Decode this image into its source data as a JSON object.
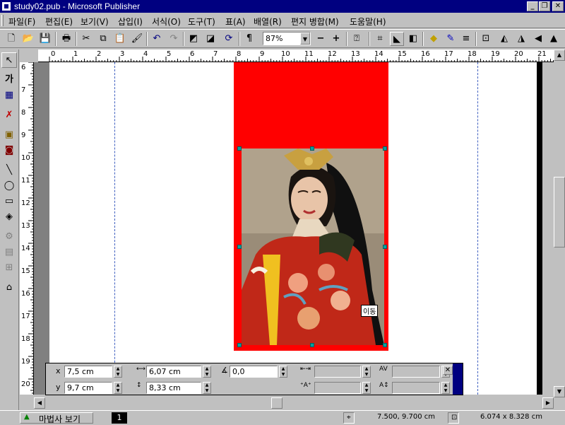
{
  "window": {
    "title": "study02.pub - Microsoft Publisher"
  },
  "menu": [
    "파일(F)",
    "편집(E)",
    "보기(V)",
    "삽입(I)",
    "서식(O)",
    "도구(T)",
    "표(A)",
    "배열(R)",
    "편지 병합(M)",
    "도움말(H)"
  ],
  "toolbar": {
    "zoom": "87%"
  },
  "ruler": {
    "h_labels": [
      "0",
      "1",
      "2",
      "3",
      "4",
      "5",
      "6",
      "7",
      "8",
      "9",
      "10",
      "11",
      "12",
      "13",
      "14",
      "15",
      "16",
      "17",
      "18",
      "19",
      "20",
      "21"
    ],
    "v_labels": [
      "6",
      "7",
      "8",
      "9",
      "10",
      "11",
      "12",
      "13",
      "14",
      "15",
      "16",
      "17",
      "18",
      "19",
      "20"
    ]
  },
  "tooltip": "이동",
  "measure": {
    "x_label": "x",
    "x_value": "7,5 cm",
    "y_label": "y",
    "y_value": "9,7 cm",
    "width_value": "6,07 cm",
    "height_value": "8,33 cm",
    "angle_value": "0,0"
  },
  "statusbar": {
    "wizard": "마법사 보기",
    "page": "1",
    "position": "7.500, 9.700 cm",
    "size": "6.074 x   8.328 cm"
  },
  "colors": {
    "titlebar": "#000080",
    "redframe": "#ff0000",
    "handle": "#00a0a0"
  }
}
